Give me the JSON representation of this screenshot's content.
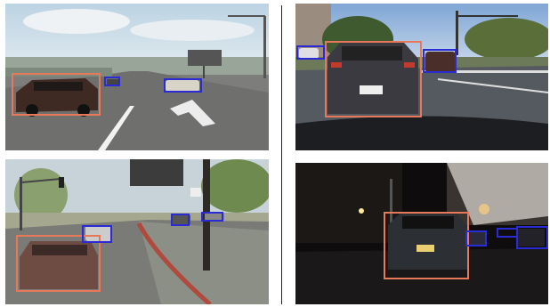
{
  "colors": {
    "near_box": "#e8785a",
    "far_box": "#2b2bd6",
    "divider": "#222222"
  },
  "panels": [
    {
      "id": "top-left",
      "scene": "synthetic-highway-day",
      "detections": [
        "near-car",
        "far-car",
        "far-car"
      ]
    },
    {
      "id": "top-right",
      "scene": "real-street-day",
      "detections": [
        "near-car",
        "far-car",
        "far-car"
      ]
    },
    {
      "id": "bottom-left",
      "scene": "synthetic-intersection-day",
      "detections": [
        "near-car",
        "far-car",
        "far-car",
        "far-car"
      ]
    },
    {
      "id": "bottom-right",
      "scene": "real-street-night",
      "detections": [
        "near-car",
        "far-car",
        "far-car",
        "far-car"
      ]
    }
  ]
}
